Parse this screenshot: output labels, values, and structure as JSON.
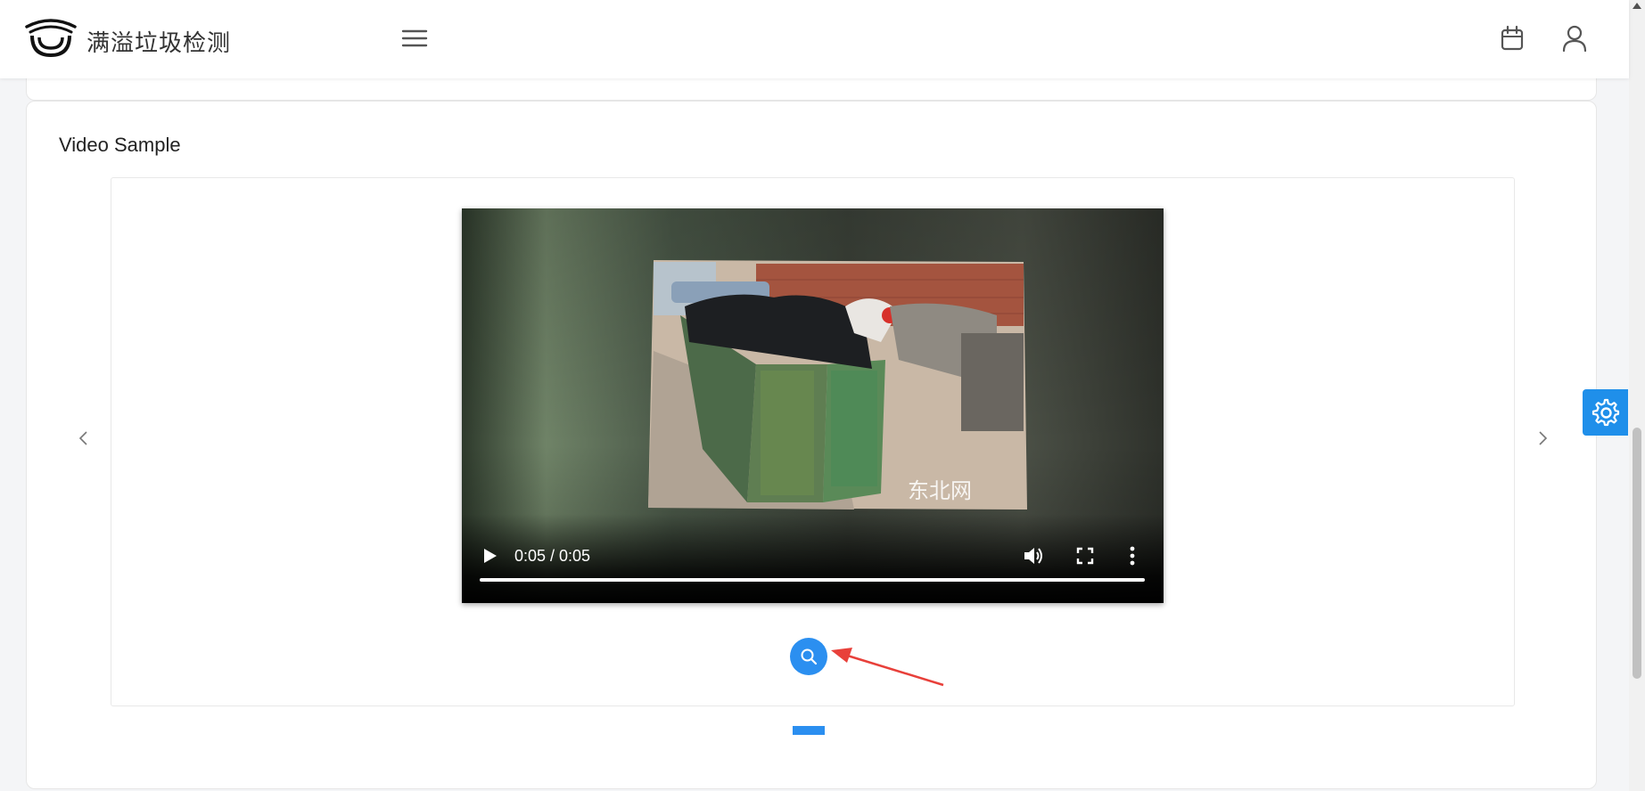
{
  "header": {
    "app_title": "满溢垃圾检测",
    "icons": {
      "logo": "eye-logo",
      "menu": "hamburger-menu-icon",
      "calendar": "calendar-icon",
      "user": "user-icon"
    }
  },
  "section": {
    "title": "Video Sample"
  },
  "video": {
    "time_display": "0:05 / 0:05",
    "progress": 1.0,
    "watermark": "东北网",
    "icons": {
      "play": "play-icon",
      "volume": "volume-icon",
      "fullscreen": "fullscreen-icon",
      "more": "more-vertical-icon"
    }
  },
  "carousel": {
    "slide_count": 1,
    "active_index": 0,
    "icons": {
      "prev": "chevron-left-icon",
      "next": "chevron-right-icon"
    }
  },
  "actions": {
    "search_icon": "search-icon",
    "settings_icon": "gear-icon"
  },
  "colors": {
    "accent": "#2b8ff0",
    "settings_bg": "#1f8fea",
    "annotation": "#e8403a"
  }
}
